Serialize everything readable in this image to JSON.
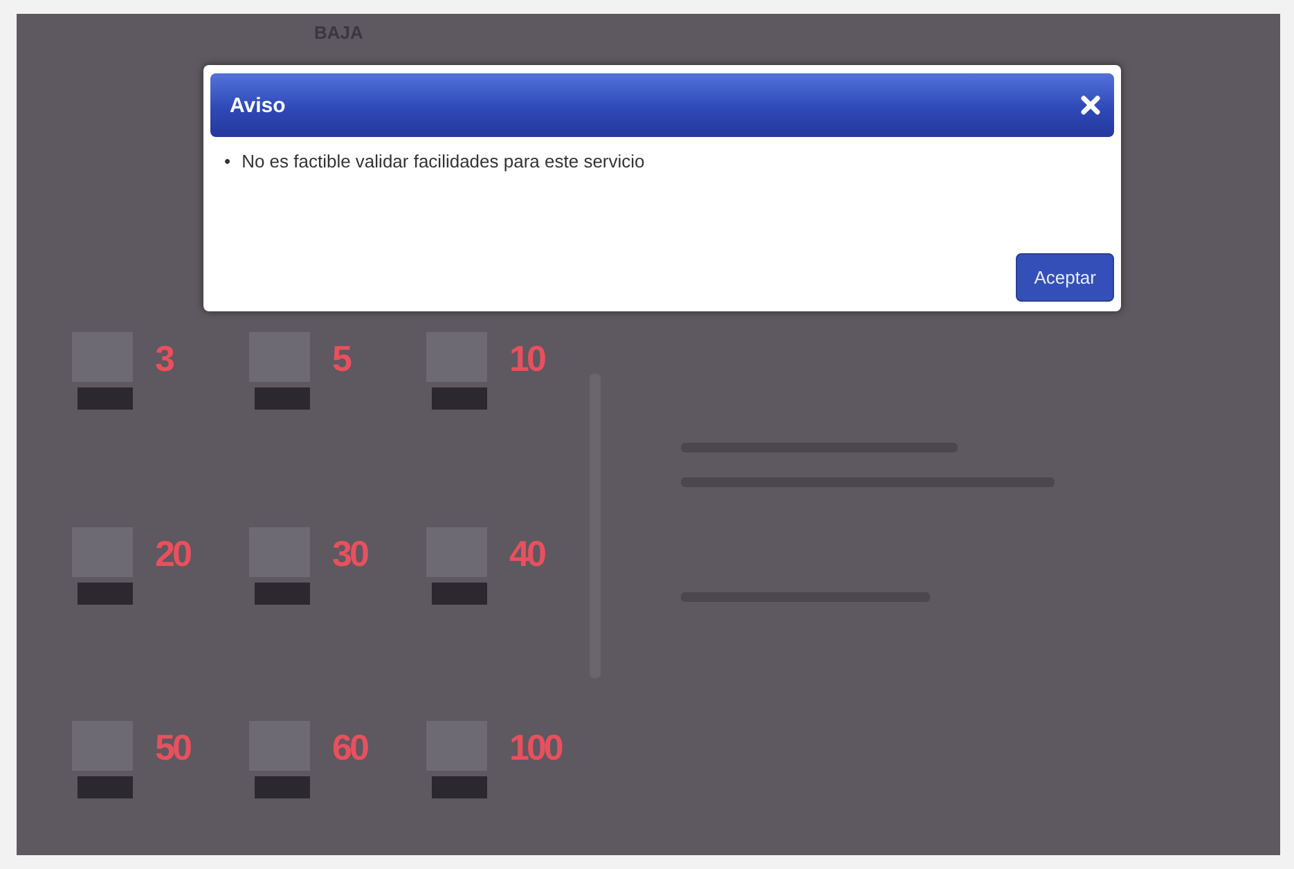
{
  "page": {
    "heading": "BAJA",
    "tiles": [
      {
        "value": "3"
      },
      {
        "value": "5"
      },
      {
        "value": "10"
      },
      {
        "value": "20"
      },
      {
        "value": "30"
      },
      {
        "value": "40"
      },
      {
        "value": "50"
      },
      {
        "value": "60"
      },
      {
        "value": "100"
      }
    ]
  },
  "dialog": {
    "title": "Aviso",
    "messages": [
      {
        "bullet": "•",
        "text": "No es factible validar facilidades para este servicio"
      }
    ],
    "buttons": [
      "Aceptar"
    ]
  }
}
